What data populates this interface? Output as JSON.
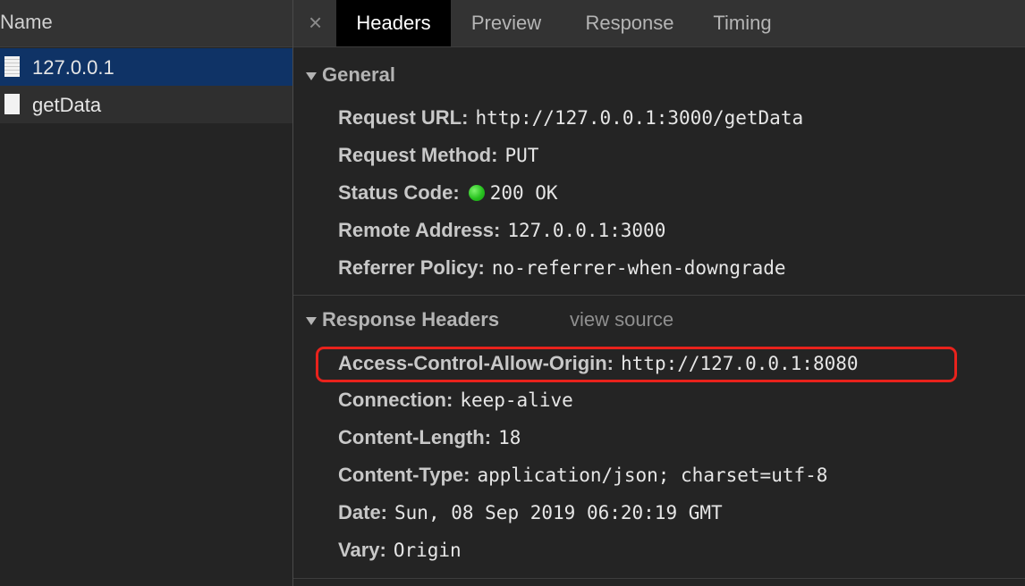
{
  "request_list": {
    "column_header": "Name",
    "items": [
      {
        "name": "127.0.0.1",
        "selected": true,
        "icon": "document-lines-icon"
      },
      {
        "name": "getData",
        "selected": false,
        "icon": "document-icon"
      }
    ]
  },
  "detail": {
    "close_glyph": "×",
    "tabs": [
      {
        "label": "Headers",
        "active": true
      },
      {
        "label": "Preview",
        "active": false
      },
      {
        "label": "Response",
        "active": false
      },
      {
        "label": "Timing",
        "active": false
      }
    ],
    "general": {
      "title": "General",
      "rows": [
        {
          "key": "Request URL:",
          "value": "http://127.0.0.1:3000/getData"
        },
        {
          "key": "Request Method:",
          "value": "PUT"
        },
        {
          "key": "Status Code:",
          "value": "200 OK",
          "status_color": "#27c21f"
        },
        {
          "key": "Remote Address:",
          "value": "127.0.0.1:3000"
        },
        {
          "key": "Referrer Policy:",
          "value": "no-referrer-when-downgrade"
        }
      ]
    },
    "response_headers": {
      "title": "Response Headers",
      "view_source": "view source",
      "highlight_color": "#e8221c",
      "rows": [
        {
          "key": "Access-Control-Allow-Origin:",
          "value": "http://127.0.0.1:8080",
          "highlighted": true
        },
        {
          "key": "Connection:",
          "value": "keep-alive"
        },
        {
          "key": "Content-Length:",
          "value": "18"
        },
        {
          "key": "Content-Type:",
          "value": "application/json; charset=utf-8"
        },
        {
          "key": "Date:",
          "value": "Sun, 08 Sep 2019 06:20:19 GMT"
        },
        {
          "key": "Vary:",
          "value": "Origin"
        }
      ]
    }
  }
}
